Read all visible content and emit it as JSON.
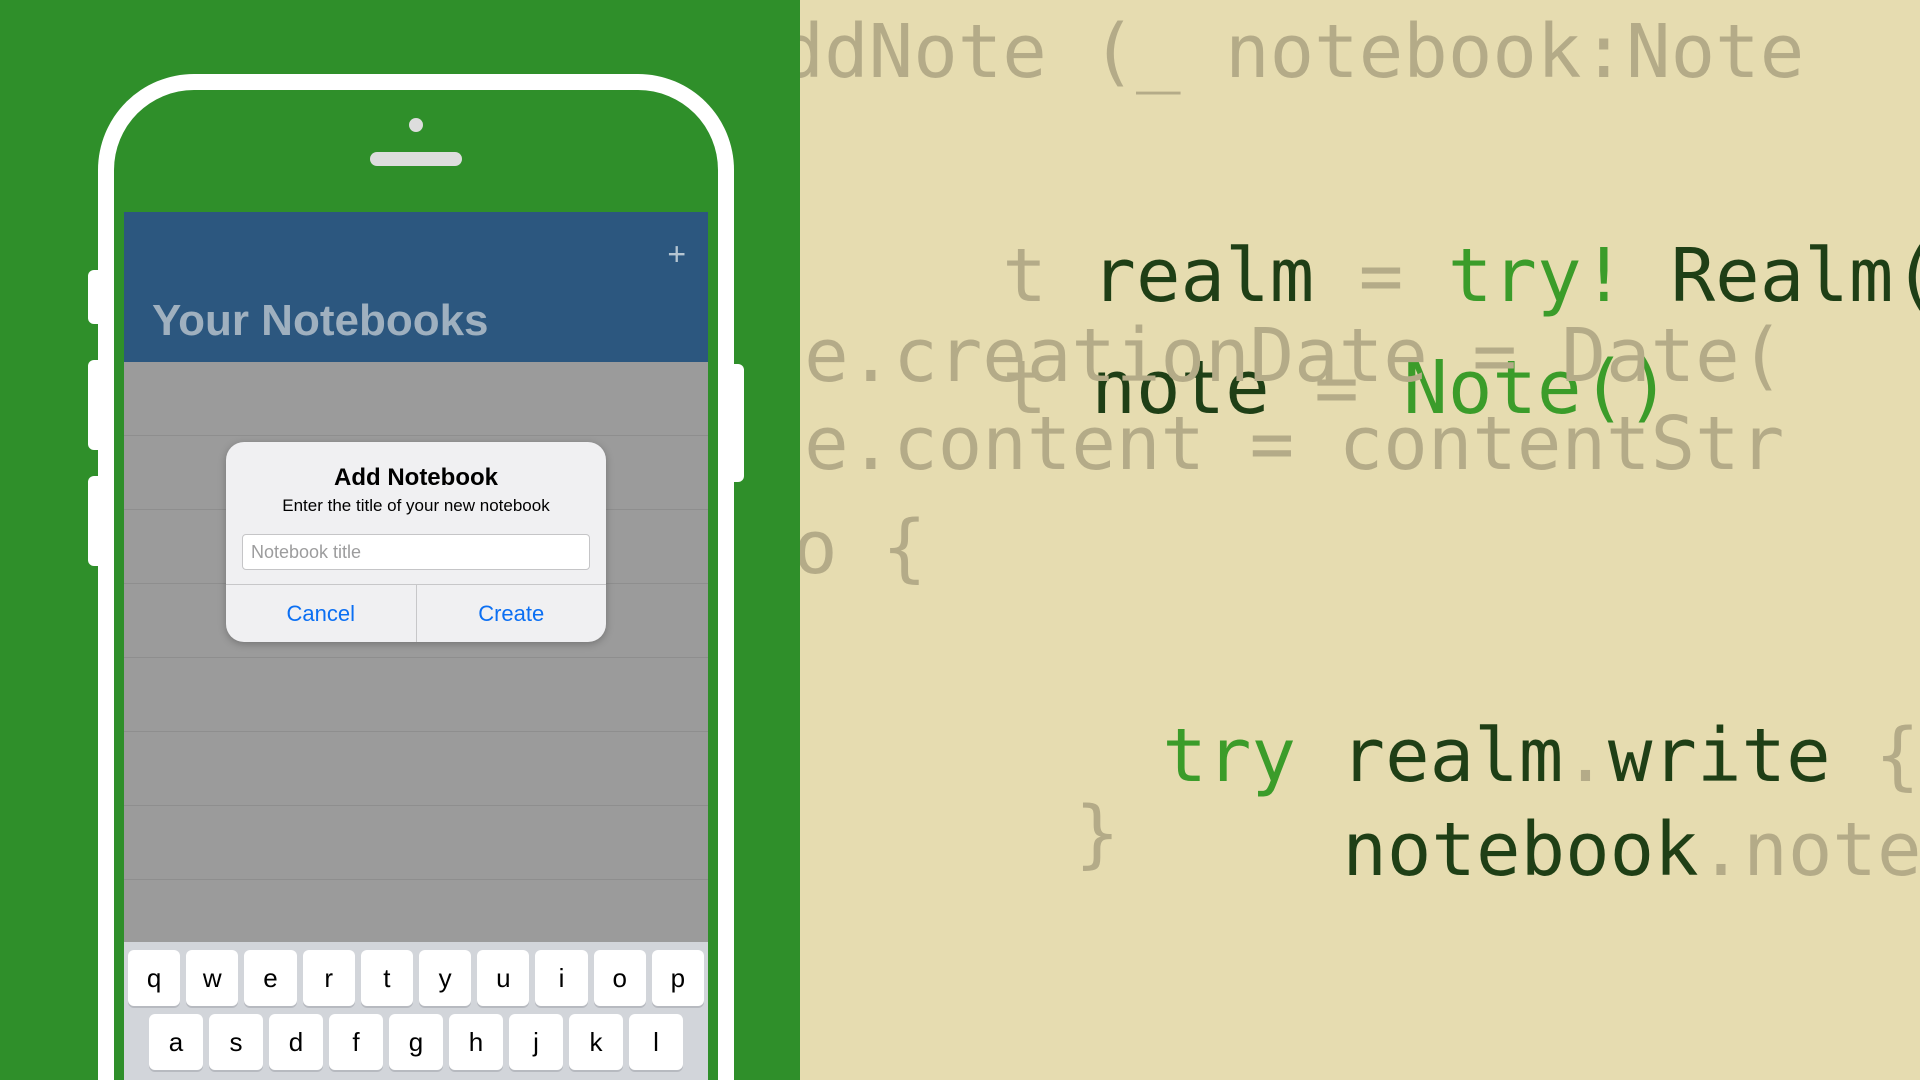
{
  "code": {
    "line1": {
      "a": "addNote (_ notebook:Note"
    },
    "line2": {
      "a": "t ",
      "realm": "realm",
      "eq": " = ",
      "try": "try!",
      "sp": " ",
      "type": "Realm()"
    },
    "line3": {
      "a": "t ",
      "note": "note",
      "eq": " = ",
      "type": "Note()"
    },
    "line4": {
      "a": "ote.creationDate = Date("
    },
    "line5": {
      "a": "ote.content = contentStr"
    },
    "line6": {
      "a": "o {"
    },
    "line7": {
      "try": "try",
      "sp": " ",
      "realm": "realm",
      "dot": ".",
      "write": "write",
      "brace": " {"
    },
    "line8": {
      "a": "notebook",
      "b": ".notes.ap"
    },
    "line9": {
      "a": "}"
    }
  },
  "phone": {
    "nav_title": "Your Notebooks",
    "add_icon_glyph": "+"
  },
  "alert": {
    "title": "Add Notebook",
    "message": "Enter the title of your new notebook",
    "placeholder": "Notebook title",
    "cancel": "Cancel",
    "create": "Create"
  },
  "keyboard": {
    "row1": [
      "q",
      "w",
      "e",
      "r",
      "t",
      "y",
      "u",
      "i",
      "o",
      "p"
    ],
    "row2": [
      "a",
      "s",
      "d",
      "f",
      "g",
      "h",
      "j",
      "k",
      "l"
    ]
  }
}
